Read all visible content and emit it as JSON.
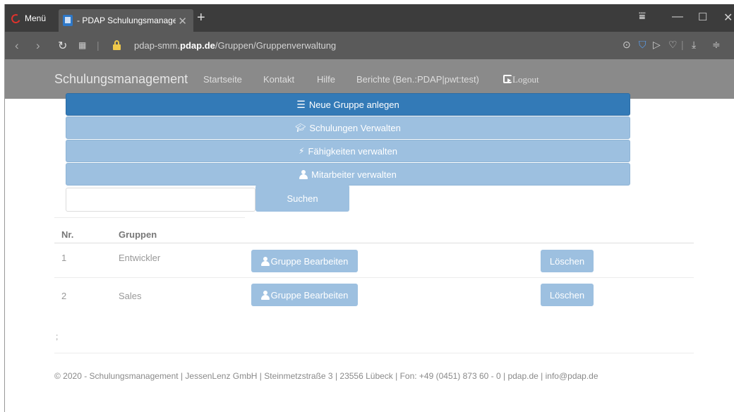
{
  "browser": {
    "menu_label": "Menü",
    "tab_title": "- PDAP Schulungsmanagement",
    "url_prefix": "pdap-smm.",
    "url_domain": "pdap.de",
    "url_path": "/Gruppen/Gruppenverwaltung"
  },
  "navbar": {
    "brand": "Schulungsmanagement",
    "links": [
      "Startseite",
      "Kontakt",
      "Hilfe",
      "Berichte (Ben.:PDAP|pwt:test)"
    ],
    "logout": "Logout"
  },
  "actions": {
    "new_group": "Neue Gruppe anlegen",
    "manage_trainings": "Schulungen Verwalten",
    "manage_skills": "Fähigkeiten verwalten",
    "manage_employees": "Mitarbeiter verwalten"
  },
  "search": {
    "value": "",
    "button": "Suchen"
  },
  "table": {
    "headers": [
      "Nr.",
      "Gruppen"
    ],
    "rows": [
      {
        "nr": "1",
        "name": "Entwickler",
        "edit": "Gruppe Bearbeiten",
        "delete": "Löschen"
      },
      {
        "nr": "2",
        "name": "Sales",
        "edit": "Gruppe Bearbeiten",
        "delete": "Löschen"
      }
    ]
  },
  "stray_text": ";",
  "footer": "© 2020 - Schulungsmanagement | JessenLenz GmbH | Steinmetzstraße 3 | 23556 Lübeck | Fon: +49 (0451) 873 60 - 0 | pdap.de | info@pdap.de",
  "colors": {
    "primary": "#337ab7",
    "light_button": "#9dc0e0",
    "navbar": "#8a8a8a"
  }
}
